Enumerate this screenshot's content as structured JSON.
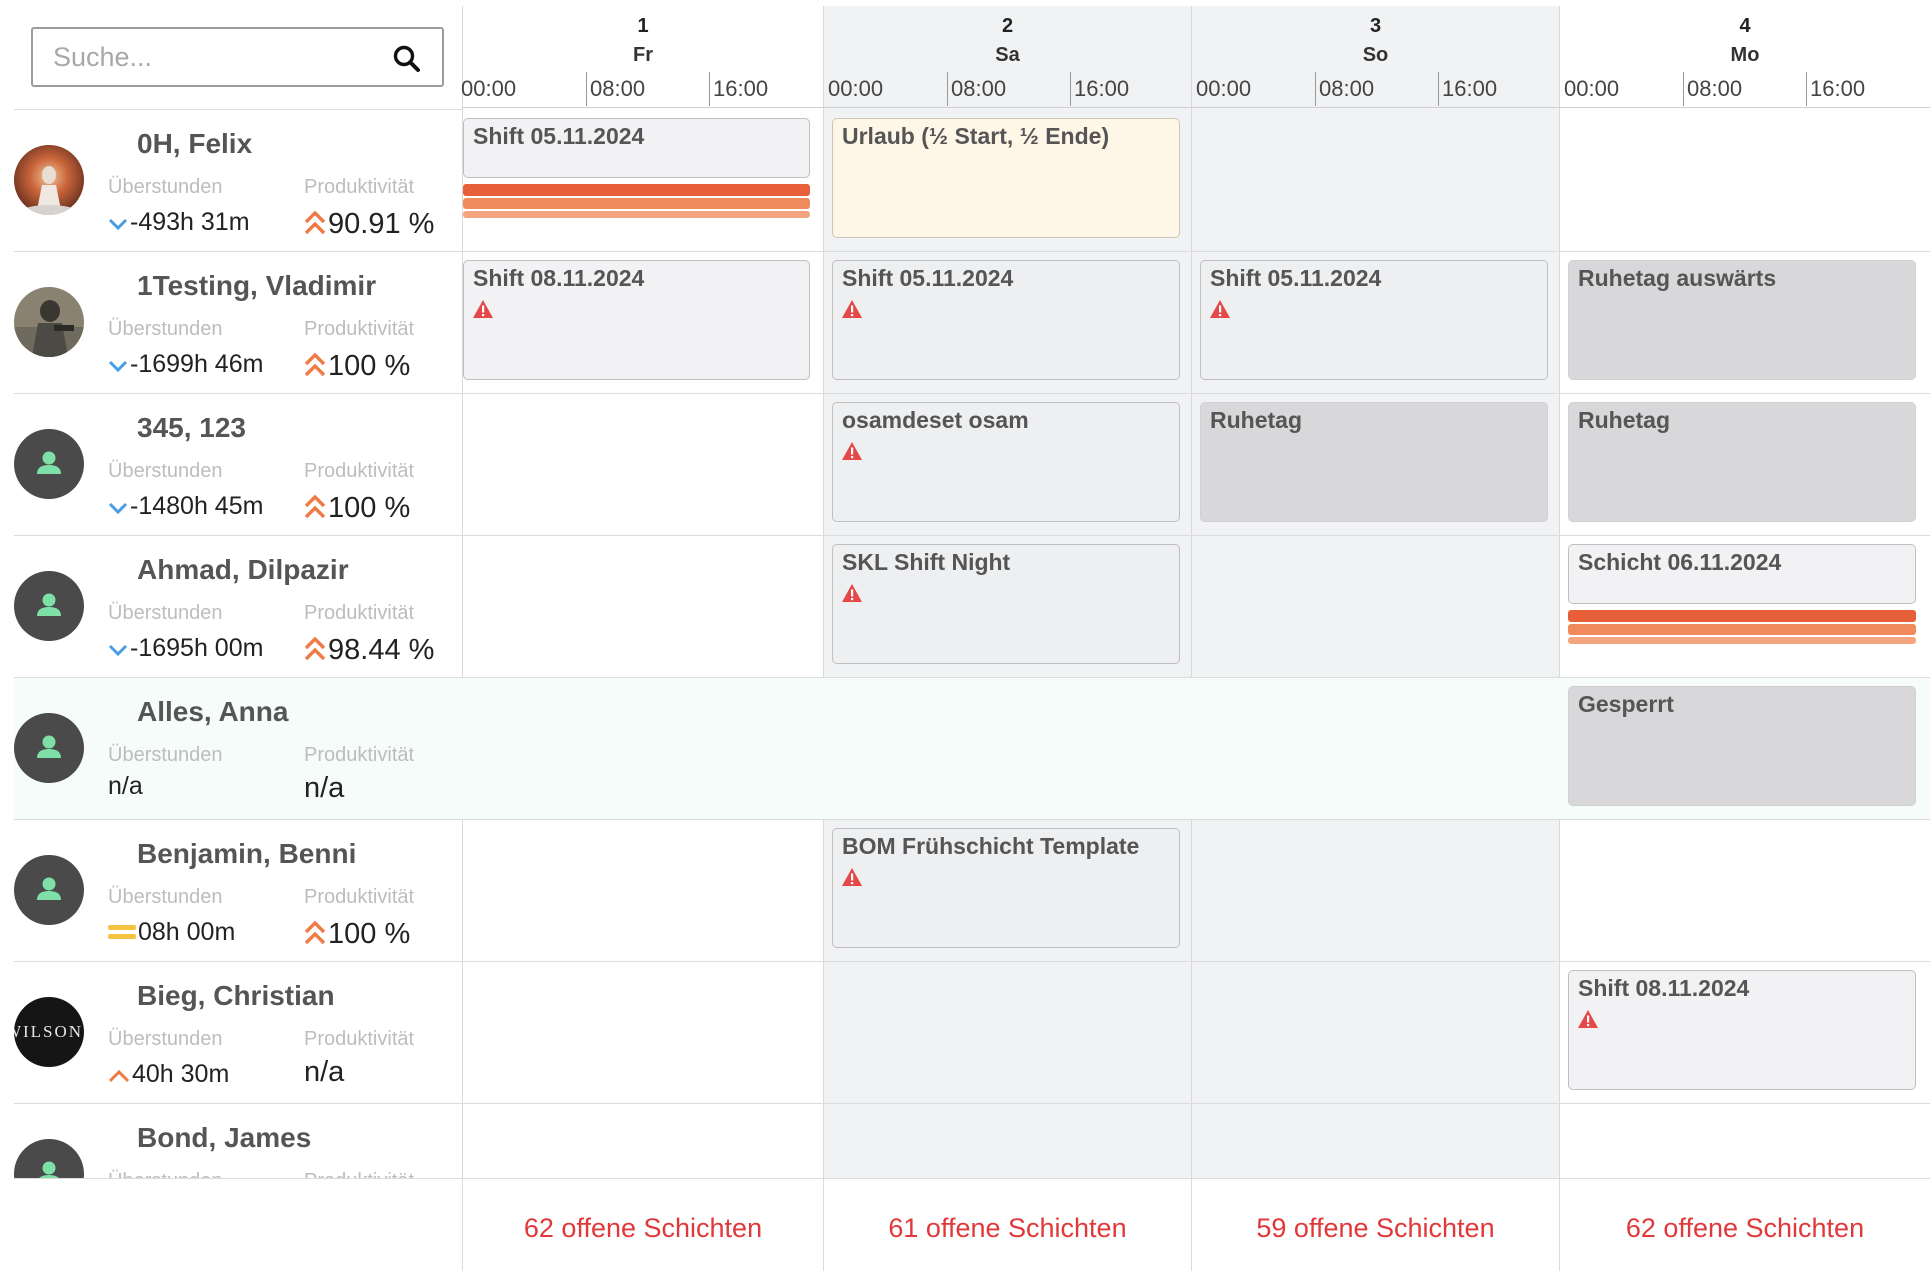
{
  "search": {
    "placeholder": "Suche..."
  },
  "labels": {
    "overtime": "Überstunden",
    "productivity": "Produktivität"
  },
  "days": [
    {
      "num": "1",
      "name": "Fr",
      "weekend": false,
      "times": [
        "00:00",
        "08:00",
        "16:00"
      ],
      "open_shifts": "62 offene Schichten"
    },
    {
      "num": "2",
      "name": "Sa",
      "weekend": true,
      "times": [
        "00:00",
        "08:00",
        "16:00"
      ],
      "open_shifts": "61 offene Schichten"
    },
    {
      "num": "3",
      "name": "So",
      "weekend": true,
      "times": [
        "00:00",
        "08:00",
        "16:00"
      ],
      "open_shifts": "59 offene Schichten"
    },
    {
      "num": "4",
      "name": "Mo",
      "weekend": false,
      "times": [
        "00:00",
        "08:00",
        "16:00"
      ],
      "open_shifts": "62 offene Schichten"
    }
  ],
  "employees": [
    {
      "name": "0H, Felix",
      "avatar": "photo-fire",
      "overtime": "-493h 31m",
      "overtime_trend": "down",
      "productivity": "90.91 %",
      "productivity_trend": "up",
      "shifts": [
        {
          "day": 0,
          "title": "Shift 05.11.2024",
          "style": "light",
          "warning": false,
          "short": true,
          "bars": true
        },
        {
          "day": 1,
          "title": "Urlaub (½ Start, ½ Ende)",
          "style": "vacation",
          "warning": false
        }
      ]
    },
    {
      "name": "1Testing, Vladimir",
      "avatar": "photo-soldier",
      "overtime": "-1699h 46m",
      "overtime_trend": "down",
      "productivity": "100 %",
      "productivity_trend": "up",
      "shifts": [
        {
          "day": 0,
          "title": "Shift 08.11.2024",
          "style": "light",
          "warning": true
        },
        {
          "day": 1,
          "title": "Shift 05.11.2024",
          "style": "normal",
          "warning": true
        },
        {
          "day": 2,
          "title": "Shift 05.11.2024",
          "style": "normal",
          "warning": true
        },
        {
          "day": 3,
          "title": "Ruhetag auswärts",
          "style": "dark",
          "warning": false
        }
      ]
    },
    {
      "name": "345, 123",
      "avatar": "default",
      "overtime": "-1480h 45m",
      "overtime_trend": "down",
      "productivity": "100 %",
      "productivity_trend": "up",
      "shifts": [
        {
          "day": 1,
          "title": "osamdeset osam",
          "style": "normal",
          "warning": true
        },
        {
          "day": 2,
          "title": "Ruhetag",
          "style": "dark",
          "warning": false
        },
        {
          "day": 3,
          "title": "Ruhetag",
          "style": "dark",
          "warning": false
        }
      ]
    },
    {
      "name": "Ahmad, Dilpazir",
      "avatar": "default",
      "overtime": "-1695h 00m",
      "overtime_trend": "down",
      "productivity": "98.44 %",
      "productivity_trend": "up",
      "shifts": [
        {
          "day": 1,
          "title": "SKL Shift Night",
          "style": "normal",
          "warning": true
        },
        {
          "day": 3,
          "title": "Schicht 06.11.2024",
          "style": "light",
          "warning": false,
          "short": true,
          "bars": true
        }
      ]
    },
    {
      "name": "Alles, Anna",
      "avatar": "default",
      "highlight": true,
      "overtime": "n/a",
      "overtime_trend": "none",
      "productivity": "n/a",
      "productivity_trend": "none",
      "shifts": [
        {
          "day": 3,
          "title": "Gesperrt",
          "style": "dark",
          "warning": false
        }
      ]
    },
    {
      "name": "Benjamin, Benni",
      "avatar": "default",
      "overtime": "08h 00m",
      "overtime_trend": "equal",
      "productivity": "100 %",
      "productivity_trend": "up",
      "shifts": [
        {
          "day": 1,
          "title": "BOM Frühschicht Template",
          "style": "normal",
          "warning": true
        }
      ]
    },
    {
      "name": "Bieg, Christian",
      "avatar": "logo-wilson",
      "logo_text": "WILSON",
      "overtime": "40h 30m",
      "overtime_trend": "up",
      "productivity": "n/a",
      "productivity_trend": "none",
      "shifts": [
        {
          "day": 3,
          "title": "Shift 08.11.2024",
          "style": "light",
          "warning": true
        }
      ]
    },
    {
      "name": "Bond, James",
      "avatar": "default",
      "overtime": "",
      "overtime_trend": "none",
      "productivity": "",
      "productivity_trend": "none",
      "shifts": []
    }
  ],
  "colors": {
    "accent_red": "#e0393b",
    "trend_down": "#4a9de2",
    "trend_up": "#f07a45",
    "trend_equal": "#f5c342",
    "avatar_person": "#7ee0a6"
  }
}
